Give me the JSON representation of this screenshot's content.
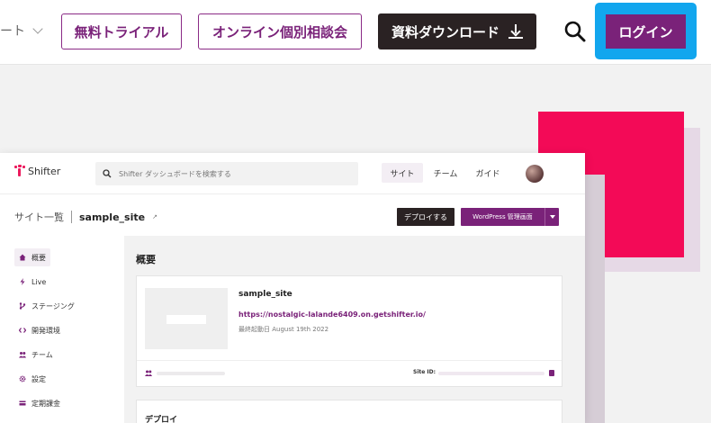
{
  "header": {
    "nav_partial": "ート",
    "trial_label": "無料トライアル",
    "consult_label": "オンライン個別相談会",
    "download_label": "資料ダウンロード",
    "login_label": "ログイン",
    "accent_color": "#7a2279",
    "highlight_color": "#12a6ee"
  },
  "dashboard": {
    "logo_text": "Shifter",
    "search_placeholder": "Shifter ダッシュボードを検索する",
    "tabs": [
      "サイト",
      "チーム",
      "ガイド"
    ],
    "breadcrumb_root": "サイト一覧",
    "breadcrumb_site": "sample_site",
    "deploy_label": "デプロイする",
    "wp_admin_label": "WordPress 管理画面",
    "sidebar": [
      {
        "label": "概要",
        "icon": "home-icon"
      },
      {
        "label": "Live",
        "icon": "bolt-icon"
      },
      {
        "label": "ステージング",
        "icon": "branch-icon"
      },
      {
        "label": "開発環境",
        "icon": "code-icon"
      },
      {
        "label": "チーム",
        "icon": "users-icon"
      },
      {
        "label": "設定",
        "icon": "gear-icon"
      },
      {
        "label": "定期課金",
        "icon": "card-icon"
      }
    ],
    "main_title": "概要",
    "site_card": {
      "name": "sample_site",
      "url": "https://nostalgic-lalande6409.on.getshifter.io/",
      "last_started": "最終起動日 August 19th 2022",
      "site_id_label": "Site ID:"
    },
    "deploy_section_title": "デプロイ"
  }
}
